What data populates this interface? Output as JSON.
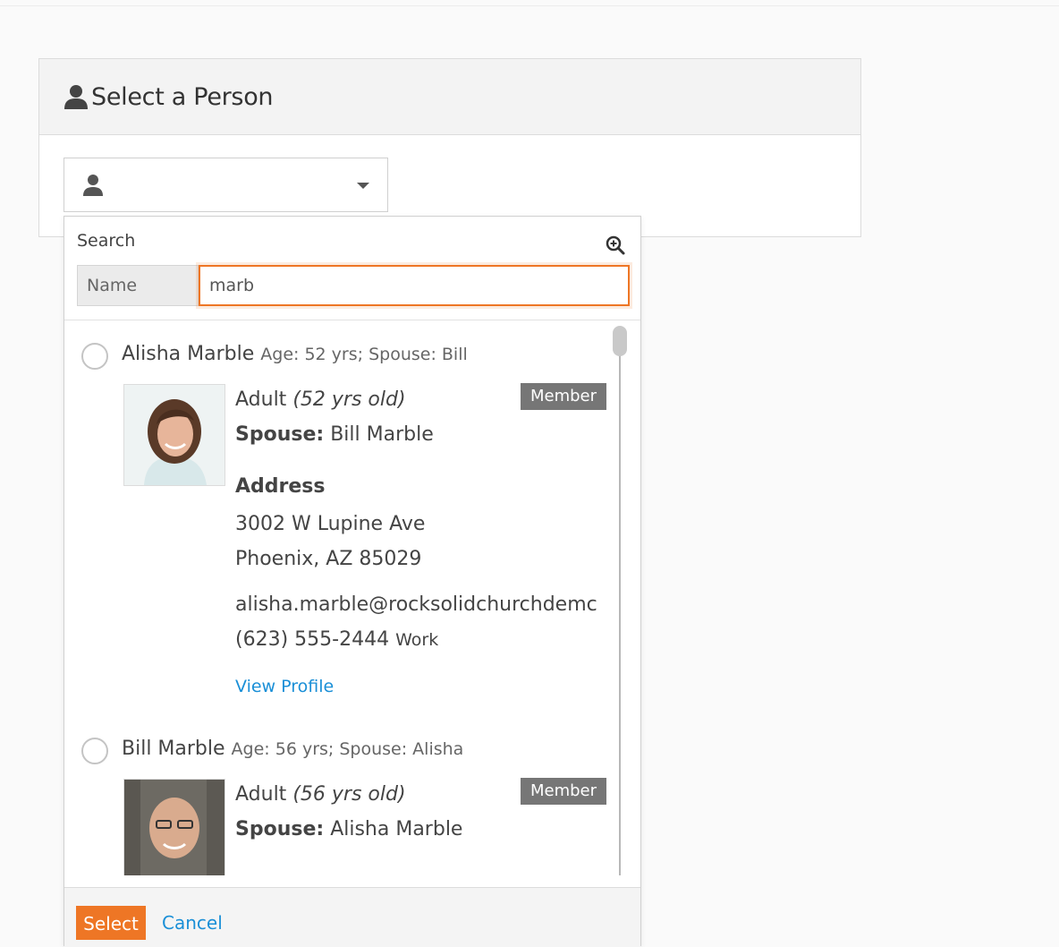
{
  "panel": {
    "title": "Select a Person"
  },
  "search": {
    "label": "Search",
    "field_addon": "Name",
    "query": "marb"
  },
  "results": [
    {
      "name": "Alisha Marble",
      "meta": "Age: 52 yrs; Spouse: Bill",
      "badge": "Member",
      "role": "Adult",
      "age_text": "(52 yrs old)",
      "spouse_label": "Spouse:",
      "spouse": "Bill Marble",
      "address_label": "Address",
      "address_line1": "3002 W Lupine Ave",
      "address_line2": "Phoenix, AZ 85029",
      "email": "alisha.marble@rocksolidchurchdemc",
      "phone": "(623) 555-2444",
      "phone_type": "Work",
      "profile_link": "View Profile"
    },
    {
      "name": "Bill Marble",
      "meta": "Age: 56 yrs; Spouse: Alisha",
      "badge": "Member",
      "role": "Adult",
      "age_text": "(56 yrs old)",
      "spouse_label": "Spouse:",
      "spouse": "Alisha Marble"
    }
  ],
  "footer": {
    "select_label": "Select",
    "cancel_label": "Cancel"
  },
  "colors": {
    "accent": "#ee7625",
    "link": "#1a8fd7",
    "badge": "#767676"
  }
}
